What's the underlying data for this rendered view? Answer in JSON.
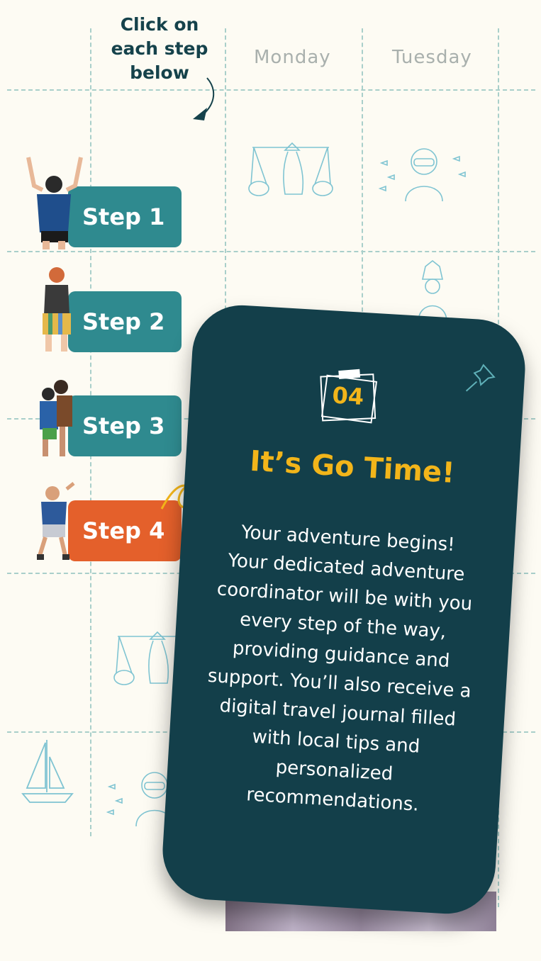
{
  "hint": {
    "line1": "Click on",
    "line2": "each step",
    "line3": "below"
  },
  "days": [
    "Monday",
    "Tuesday"
  ],
  "steps": [
    {
      "label": "Step 1",
      "active": false
    },
    {
      "label": "Step 2",
      "active": false
    },
    {
      "label": "Step 3",
      "active": false
    },
    {
      "label": "Step 4",
      "active": true
    }
  ],
  "card": {
    "number": "04",
    "title": "It’s Go Time!",
    "lines": [
      "Your adventure begins!",
      "Your dedicated adventure",
      "coordinator will be with you",
      "every step of the way,",
      "providing guidance and",
      "support. You’ll also receive a",
      "digital travel journal filled",
      "with local tips and",
      "personalized",
      "recommendations."
    ]
  },
  "colors": {
    "teal": "#2f8a8f",
    "orange": "#e4602b",
    "card": "#133f4a",
    "accent": "#f2b51a",
    "dark_text": "#15424b"
  },
  "icons": [
    "arrow-down-icon",
    "pushpin-icon",
    "curved-arrow-icon",
    "sailboat-icon"
  ]
}
